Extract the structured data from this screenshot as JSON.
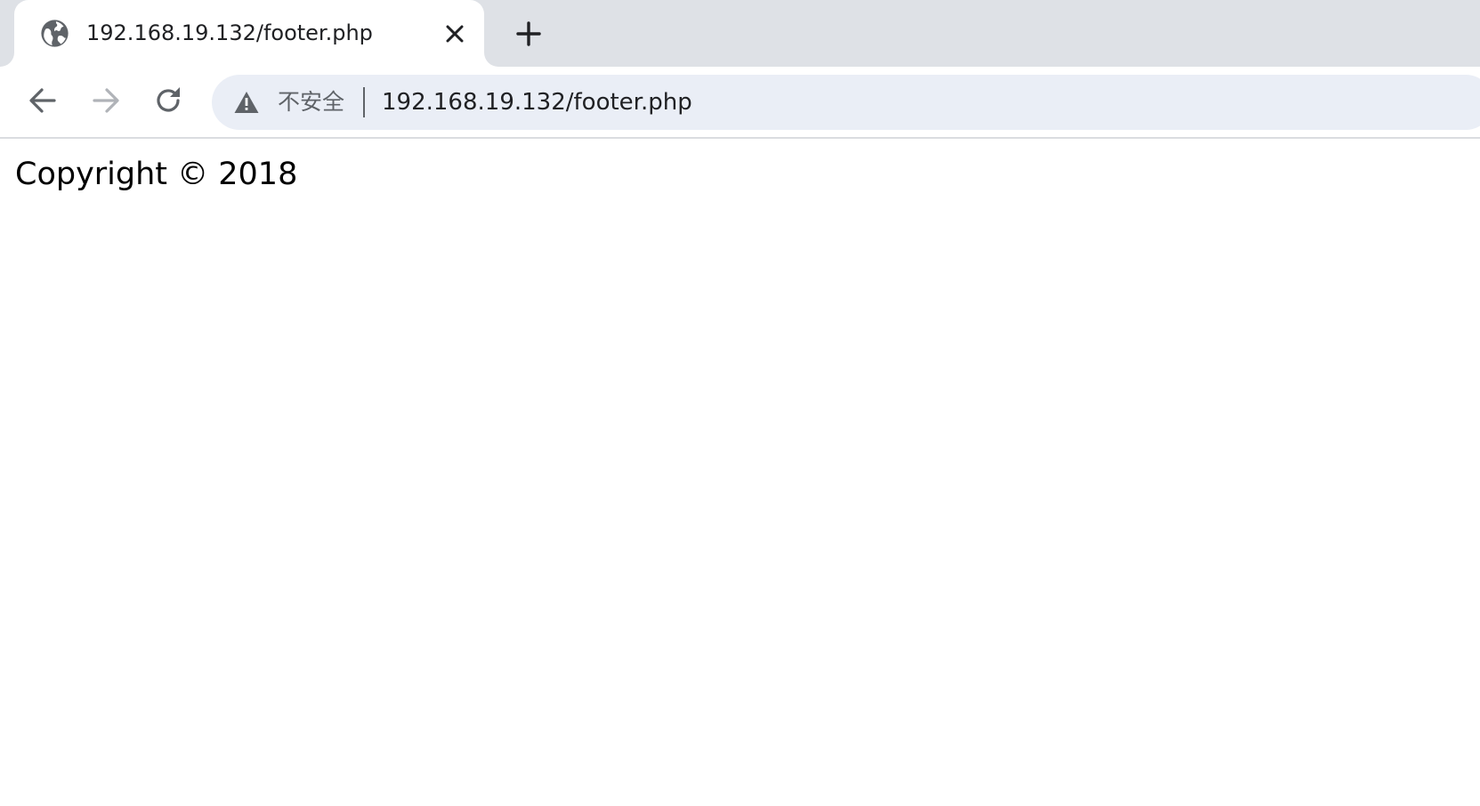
{
  "tab": {
    "title": "192.168.19.132/footer.php",
    "favicon": "globe-icon",
    "close_icon": "close-icon"
  },
  "new_tab": {
    "icon": "plus-icon"
  },
  "toolbar": {
    "back_icon": "arrow-left-icon",
    "forward_icon": "arrow-right-icon",
    "reload_icon": "reload-icon"
  },
  "omnibox": {
    "security_icon": "warning-triangle-icon",
    "security_label": "不安全",
    "url": "192.168.19.132/footer.php"
  },
  "page": {
    "text": "Copyright © 2018"
  },
  "colors": {
    "tab_strip": "#dee1e6",
    "omnibox": "#eaeef6",
    "icon": "#5f6368",
    "icon_disabled": "#b0b3b8"
  }
}
